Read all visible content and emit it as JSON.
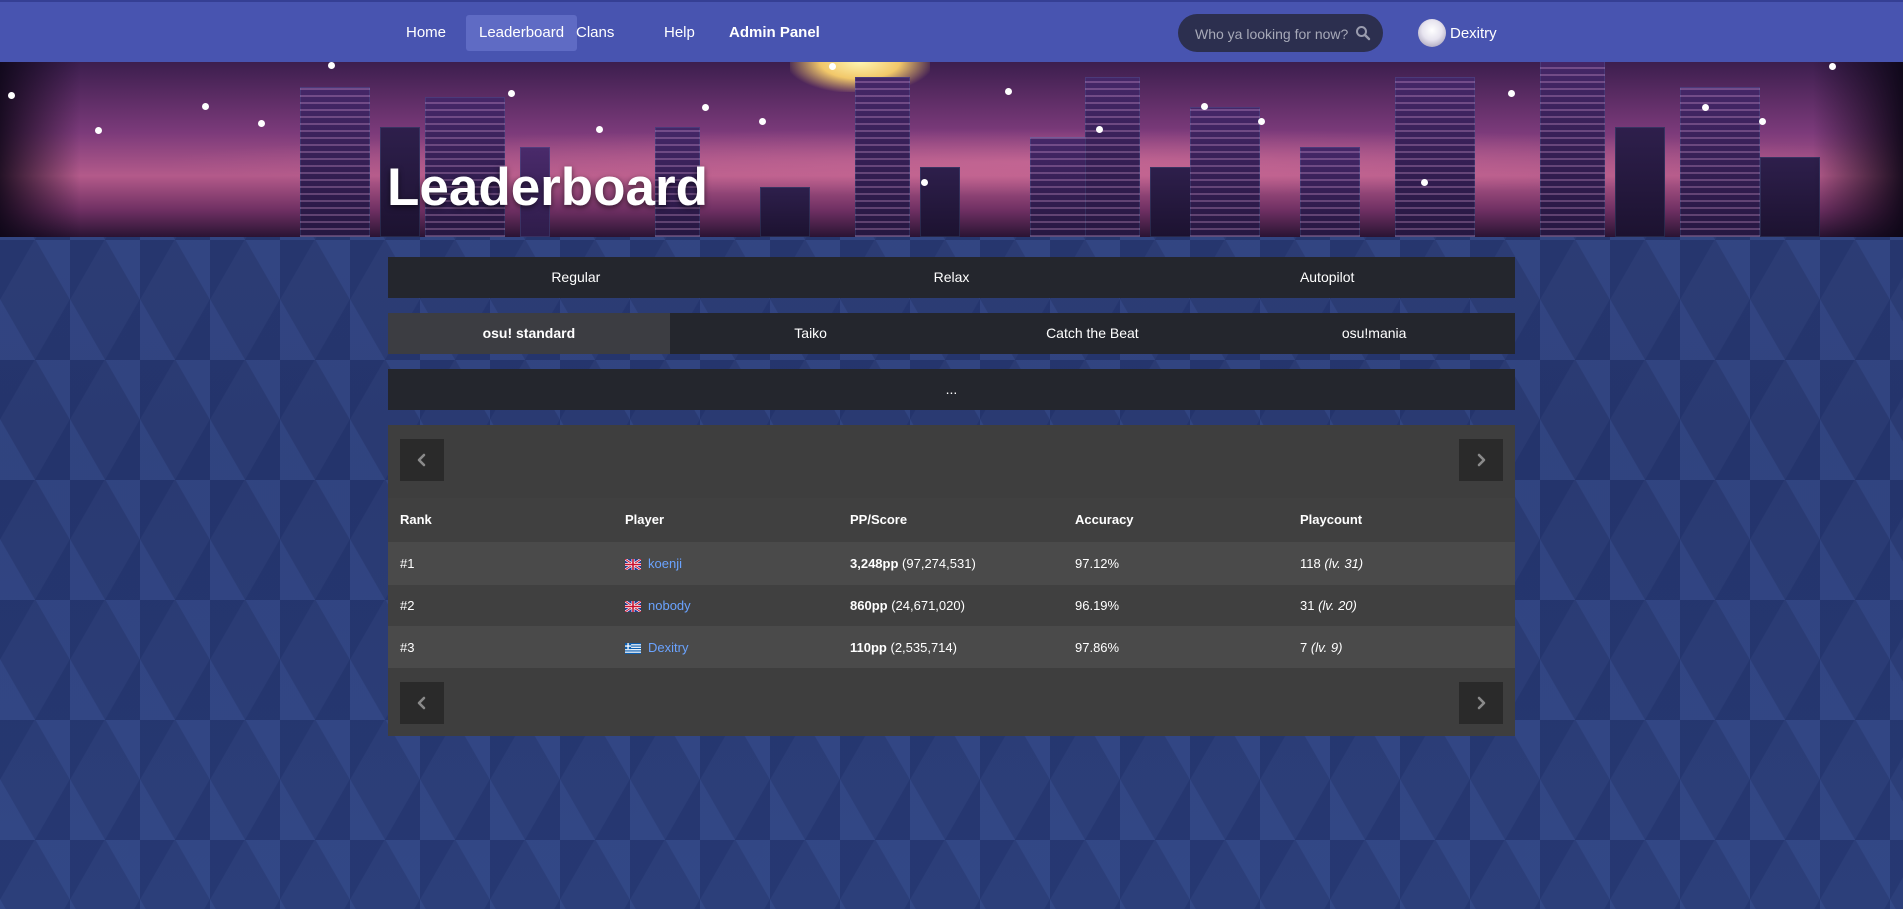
{
  "nav": {
    "items": [
      {
        "label": "Home",
        "active": false
      },
      {
        "label": "Leaderboard",
        "active": true
      },
      {
        "label": "Clans",
        "active": false
      },
      {
        "label": "Help",
        "active": false
      },
      {
        "label": "Admin Panel",
        "active": false
      }
    ],
    "search_placeholder": "Who ya looking for now?",
    "search_icon": "search-icon",
    "user_name": "Dexitry"
  },
  "hero": {
    "title": "Leaderboard"
  },
  "tabs": {
    "mods": [
      "Regular",
      "Relax",
      "Autopilot"
    ],
    "modes": [
      "osu! standard",
      "Taiko",
      "Catch the Beat",
      "osu!mania"
    ],
    "active_mode": "osu! standard",
    "extra": "..."
  },
  "table": {
    "headers": [
      "Rank",
      "Player",
      "PP/Score",
      "Accuracy",
      "Playcount"
    ],
    "rows": [
      {
        "rank": "#1",
        "flag": "gb",
        "player": "koenji",
        "pp": "3,248pp",
        "score": "(97,274,531)",
        "accuracy": "97.12%",
        "playcount": "118",
        "level": "(lv. 31)"
      },
      {
        "rank": "#2",
        "flag": "gb",
        "player": "nobody",
        "pp": "860pp",
        "score": "(24,671,020)",
        "accuracy": "96.19%",
        "playcount": "31",
        "level": "(lv. 20)"
      },
      {
        "rank": "#3",
        "flag": "gr",
        "player": "Dexitry",
        "pp": "110pp",
        "score": "(2,535,714)",
        "accuracy": "97.86%",
        "playcount": "7",
        "level": "(lv. 9)"
      }
    ]
  },
  "colors": {
    "navbar": "#4854b0",
    "link": "#6aa3ff",
    "panel": "#3e3e3e"
  }
}
